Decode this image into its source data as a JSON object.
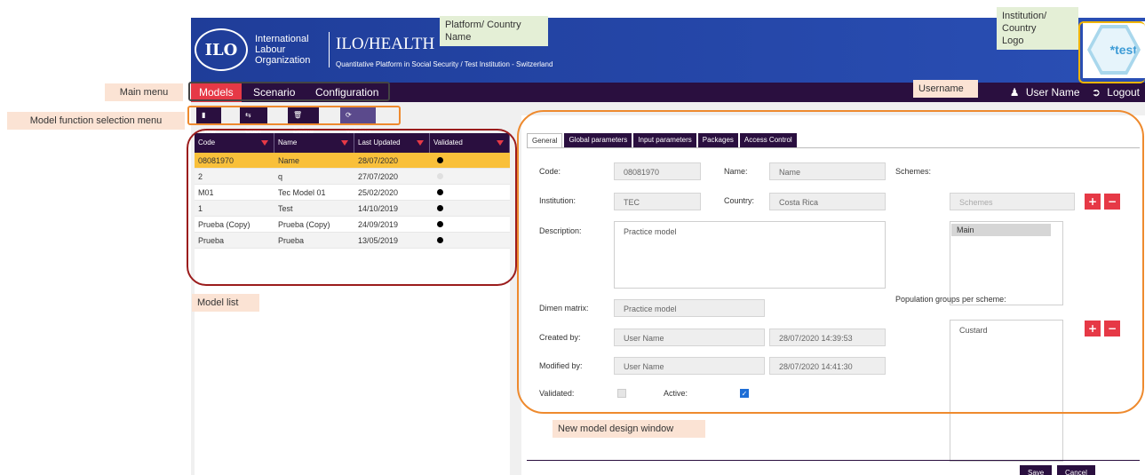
{
  "header": {
    "org_name": "International\nLabour\nOrganization",
    "logo_text": "ILO",
    "app_title": "ILO/HEALTH",
    "app_subtitle": "Quantitative Platform in Social Security / Test Institution - Switzerland",
    "institution_logo_text": "*test"
  },
  "nav": {
    "items": [
      "Models",
      "Scenario",
      "Configuration"
    ],
    "active": "Models",
    "username": "User Name",
    "logout": "Logout"
  },
  "toolbar": {
    "new": "New",
    "copy": "Copy",
    "delete": "Delete",
    "validate": "Validate"
  },
  "grid": {
    "columns": [
      "Code",
      "Name",
      "Last Updated",
      "Validated"
    ],
    "rows": [
      {
        "code": "08081970",
        "name": "Name",
        "updated": "28/07/2020",
        "validated": true,
        "selected": true
      },
      {
        "code": "2",
        "name": "q",
        "updated": "27/07/2020",
        "validated": false
      },
      {
        "code": "M01",
        "name": "Tec Model 01",
        "updated": "25/02/2020",
        "validated": true
      },
      {
        "code": "1",
        "name": "Test",
        "updated": "14/10/2019",
        "validated": true
      },
      {
        "code": "Prueba (Copy)",
        "name": "Prueba (Copy)",
        "updated": "24/09/2019",
        "validated": true
      },
      {
        "code": "Prueba",
        "name": "Prueba",
        "updated": "13/05/2019",
        "validated": true
      }
    ]
  },
  "tabs": [
    "General",
    "Global parameters",
    "Input parameters",
    "Packages",
    "Access Control"
  ],
  "form": {
    "code_label": "Code:",
    "code_value": "08081970",
    "name_label": "Name:",
    "name_value": "Name",
    "institution_label": "Institution:",
    "institution_value": "TEC",
    "country_label": "Country:",
    "country_value": "Costa Rica",
    "description_label": "Description:",
    "description_value": "Practice model",
    "dimen_label": "Dimen matrix:",
    "dimen_value": "Practice model",
    "created_label": "Created by:",
    "created_by": "User Name",
    "created_at": "28/07/2020 14:39:53",
    "modified_label": "Modified by:",
    "modified_by": "User Name",
    "modified_at": "28/07/2020 14:41:30",
    "validated_label": "Validated:",
    "active_label": "Active:",
    "schemes_label": "Schemes:",
    "schemes_placeholder": "Schemes",
    "schemes_items": [
      "Main"
    ],
    "population_label": "Population groups per scheme:",
    "population_items": [
      "Custard"
    ],
    "save": "Save",
    "cancel": "Cancel"
  },
  "annotations": {
    "platform": "Platform/ Country\nName",
    "institution_logo": "Institution/\nCountry\nLogo",
    "main_menu": "Main menu",
    "function_menu": "Model function selection menu",
    "username": "Username",
    "model_list": "Model list",
    "design_window": "New model design window"
  },
  "colors": {
    "header_blue": "#1f3d99",
    "nav_purple": "#2a0f3f",
    "accent_red": "#e63946",
    "selected_row": "#f9c03a",
    "ring_orange": "#ee8a2e",
    "ring_darkred": "#9b1c1c"
  }
}
